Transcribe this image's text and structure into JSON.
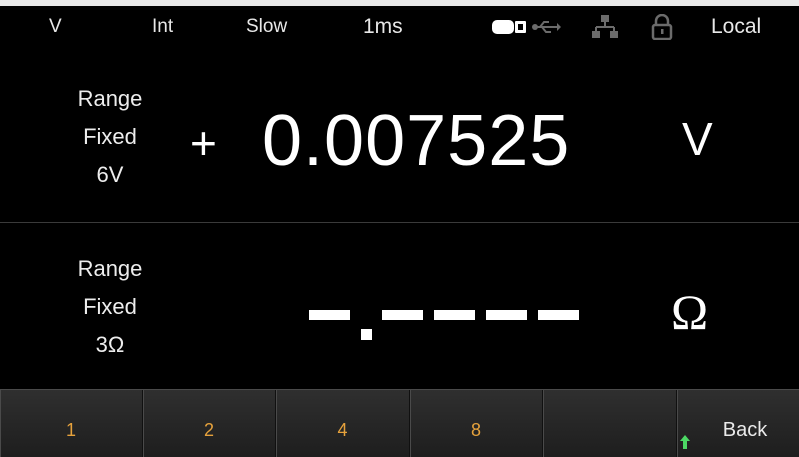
{
  "status_bar": {
    "function": "V",
    "trigger": "Int",
    "speed": "Slow",
    "aperture": "1ms",
    "mode": "Local",
    "icons": [
      "card-icon",
      "usb-icon",
      "network-icon",
      "lock-icon"
    ]
  },
  "primary": {
    "range_line1": "Range",
    "range_line2": "Fixed",
    "range_line3": "6V",
    "sign": "+",
    "value": "0.007525",
    "unit": "V"
  },
  "secondary": {
    "range_line1": "Range",
    "range_line2": "Fixed",
    "range_line3": "3Ω",
    "unit": "Ω"
  },
  "softkeys": {
    "key1": "1",
    "key2": "2",
    "key3": "4",
    "key4": "8",
    "key5": "",
    "key6": "Back",
    "colors": {
      "numeric": "#e6a23c",
      "arrow": "#4cd964"
    }
  }
}
